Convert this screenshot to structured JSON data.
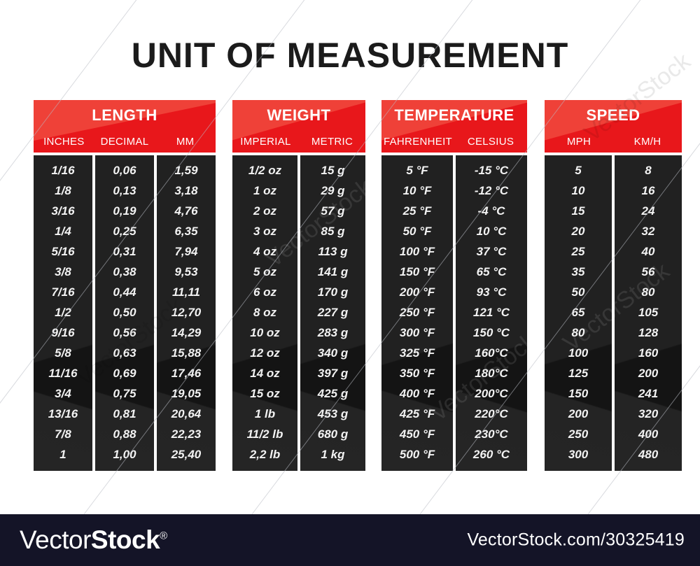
{
  "title": "UNIT OF MEASUREMENT",
  "tables": [
    {
      "name": "LENGTH",
      "columns": [
        "INCHES",
        "DECIMAL",
        "MM"
      ],
      "rows": [
        [
          "1/16",
          "0,06",
          "1,59"
        ],
        [
          "1/8",
          "0,13",
          "3,18"
        ],
        [
          "3/16",
          "0,19",
          "4,76"
        ],
        [
          "1/4",
          "0,25",
          "6,35"
        ],
        [
          "5/16",
          "0,31",
          "7,94"
        ],
        [
          "3/8",
          "0,38",
          "9,53"
        ],
        [
          "7/16",
          "0,44",
          "11,11"
        ],
        [
          "1/2",
          "0,50",
          "12,70"
        ],
        [
          "9/16",
          "0,56",
          "14,29"
        ],
        [
          "5/8",
          "0,63",
          "15,88"
        ],
        [
          "11/16",
          "0,69",
          "17,46"
        ],
        [
          "3/4",
          "0,75",
          "19,05"
        ],
        [
          "13/16",
          "0,81",
          "20,64"
        ],
        [
          "7/8",
          "0,88",
          "22,23"
        ],
        [
          "1",
          "1,00",
          "25,40"
        ]
      ]
    },
    {
      "name": "WEIGHT",
      "columns": [
        "IMPERIAL",
        "METRIC"
      ],
      "rows": [
        [
          "1/2 oz",
          "15 g"
        ],
        [
          "1 oz",
          "29 g"
        ],
        [
          "2 oz",
          "57 g"
        ],
        [
          "3 oz",
          "85 g"
        ],
        [
          "4 oz",
          "113 g"
        ],
        [
          "5 oz",
          "141 g"
        ],
        [
          "6 oz",
          "170 g"
        ],
        [
          "8 oz",
          "227 g"
        ],
        [
          "10 oz",
          "283 g"
        ],
        [
          "12 oz",
          "340 g"
        ],
        [
          "14 oz",
          "397 g"
        ],
        [
          "15 oz",
          "425 g"
        ],
        [
          "1 lb",
          "453 g"
        ],
        [
          "11/2 lb",
          "680 g"
        ],
        [
          "2,2 lb",
          "1 kg"
        ]
      ]
    },
    {
      "name": "TEMPERATURE",
      "columns": [
        "FAHRENHEIT",
        "CELSIUS"
      ],
      "rows": [
        [
          "5 °F",
          "-15 °C"
        ],
        [
          "10 °F",
          "-12 °C"
        ],
        [
          "25 °F",
          "-4 °C"
        ],
        [
          "50 °F",
          "10 °C"
        ],
        [
          "100 °F",
          "37 °C"
        ],
        [
          "150 °F",
          "65 °C"
        ],
        [
          "200 °F",
          "93 °C"
        ],
        [
          "250 °F",
          "121 °C"
        ],
        [
          "300 °F",
          "150 °C"
        ],
        [
          "325 °F",
          "160°C"
        ],
        [
          "350 °F",
          "180°C"
        ],
        [
          "400 °F",
          "200°C"
        ],
        [
          "425 °F",
          "220°C"
        ],
        [
          "450 °F",
          "230°C"
        ],
        [
          "500 °F",
          "260 °C"
        ]
      ]
    },
    {
      "name": "SPEED",
      "columns": [
        "MPH",
        "KM/H"
      ],
      "rows": [
        [
          "5",
          "8"
        ],
        [
          "10",
          "16"
        ],
        [
          "15",
          "24"
        ],
        [
          "20",
          "32"
        ],
        [
          "25",
          "40"
        ],
        [
          "35",
          "56"
        ],
        [
          "50",
          "80"
        ],
        [
          "65",
          "105"
        ],
        [
          "80",
          "128"
        ],
        [
          "100",
          "160"
        ],
        [
          "125",
          "200"
        ],
        [
          "150",
          "241"
        ],
        [
          "200",
          "320"
        ],
        [
          "250",
          "400"
        ],
        [
          "300",
          "480"
        ]
      ]
    }
  ],
  "footer": {
    "logo_light": "Vector",
    "logo_bold": "Stock",
    "logo_mark": "®",
    "url": "VectorStock.com/30325419"
  },
  "watermark_text": "VectorStock",
  "colors": {
    "red": "#e8171b",
    "red_light": "#ef4138",
    "panel": "#141414",
    "title": "#1b1b1b",
    "footer_bg": "#141427",
    "text_light": "#f2f2f2"
  }
}
